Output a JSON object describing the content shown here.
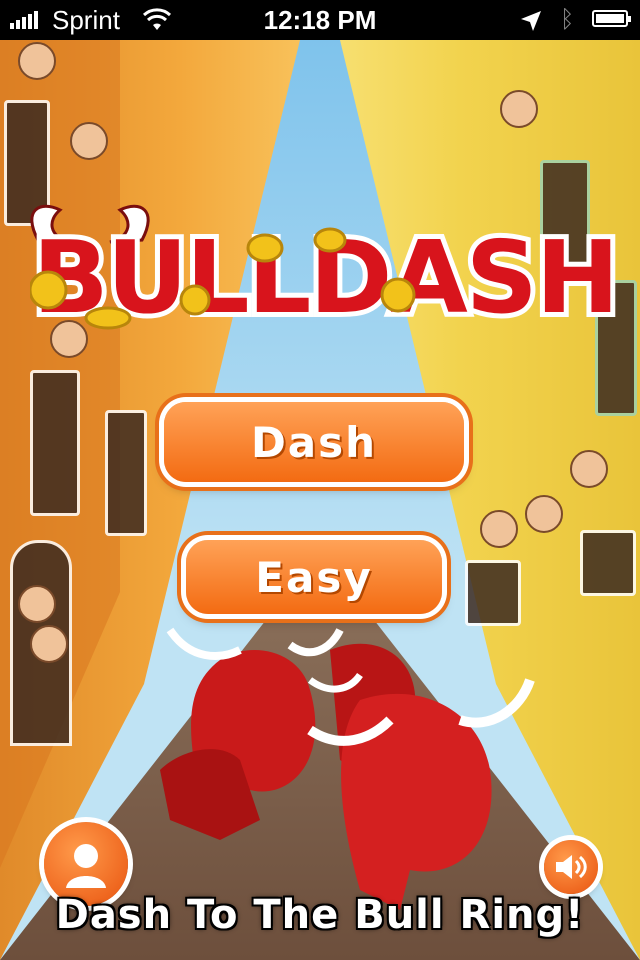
{
  "status_bar": {
    "carrier": "Sprint",
    "time": "12:18 PM",
    "battery_level": 1.0
  },
  "logo": {
    "text": "BULLDASH"
  },
  "menu": {
    "dash_label": "Dash",
    "easy_label": "Easy"
  },
  "footer": {
    "tagline": "Dash To The Bull Ring!"
  },
  "icons": {
    "profile": "person-silhouette-icon",
    "sound": "speaker-icon"
  },
  "colors": {
    "button_orange": "#f36b12",
    "logo_red": "#d8141c",
    "coin_gold": "#f2c21a"
  }
}
